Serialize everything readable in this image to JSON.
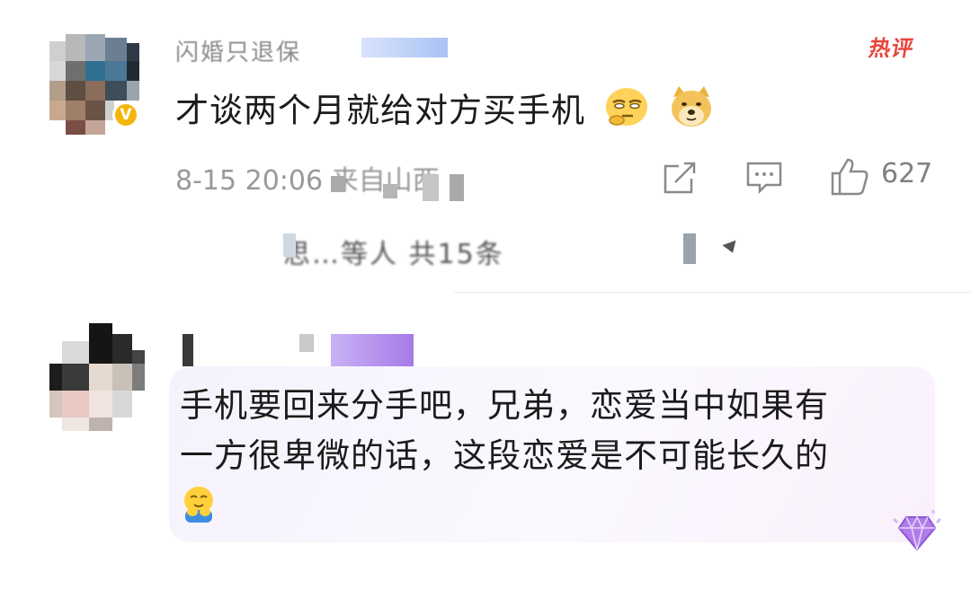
{
  "comment_1": {
    "username": "闪婚只退保",
    "badge": "V",
    "hot_tag": "热评",
    "text": "才谈两个月就给对方买手机",
    "emojis": [
      "thinking-face-emoji",
      "doge-emoji"
    ],
    "timestamp": "8-15 20:06",
    "location": "来自山西",
    "like_count": "627"
  },
  "replies_link": {
    "text": "思…等人 共15条"
  },
  "comment_2": {
    "text_line_1": "手机要回来分手吧，兄弟，恋爱当中如果有",
    "text_line_2": "一方很卑微的话，这段恋爱是不可能长久的",
    "emoji": "hug-emoji"
  },
  "colors": {
    "hot_tag": "#e8453c",
    "verified_badge": "#f5b60a",
    "meta_text": "#999999",
    "bubble_bg": "#f7f2fd",
    "name_highlight": "#b48cf0"
  }
}
